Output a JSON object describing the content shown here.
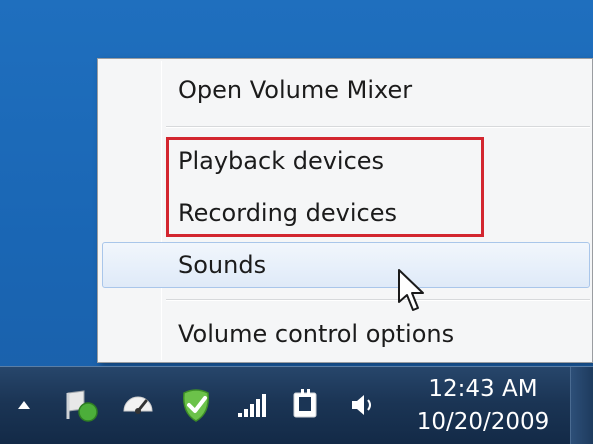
{
  "context_menu": {
    "items": [
      {
        "label": "Open Volume Mixer"
      },
      {
        "label": "Playback devices"
      },
      {
        "label": "Recording devices"
      },
      {
        "label": "Sounds"
      },
      {
        "label": "Volume control options"
      }
    ],
    "hovered_item": "Sounds",
    "highlight_color": "#d3262f"
  },
  "taskbar": {
    "tray_icons": [
      "show-hidden-icons-arrow",
      "action-center-icon",
      "speedometer-icon",
      "security-shield-icon",
      "network-signal-icon",
      "power-plug-icon",
      "speaker-volume-icon"
    ],
    "clock": {
      "time": "12:43 AM",
      "date": "10/20/2009"
    }
  },
  "colors": {
    "desktop_bg": "#1f6fbe",
    "taskbar_bg": "#1b3555",
    "menu_bg": "#f5f6f7",
    "menu_hover": "#dfeaf8"
  }
}
